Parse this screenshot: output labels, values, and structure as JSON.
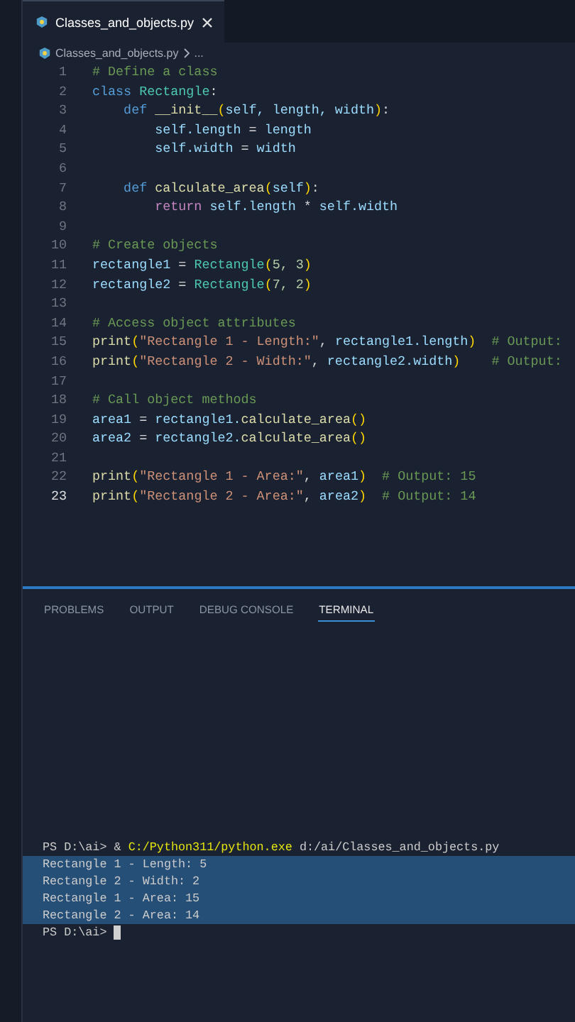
{
  "tab": {
    "label": "Classes_and_objects.py",
    "selected": true
  },
  "breadcrumb": {
    "file": "Classes_and_objects.py",
    "rest": "..."
  },
  "code": [
    {
      "number": "1",
      "active": false,
      "tokens": [
        {
          "kind": "comment",
          "t": "# Define a class"
        }
      ]
    },
    {
      "number": "2",
      "active": false,
      "tokens": [
        {
          "kind": "keyword",
          "t": "class "
        },
        {
          "kind": "cls",
          "t": "Rectangle"
        },
        {
          "kind": "punct",
          "t": ":"
        }
      ]
    },
    {
      "number": "3",
      "active": false,
      "tokens": [
        {
          "kind": "keyword",
          "t": "    def "
        },
        {
          "kind": "func",
          "t": "__init__"
        },
        {
          "kind": "paren",
          "t": "("
        },
        {
          "kind": "var",
          "t": "self, length, width"
        },
        {
          "kind": "paren",
          "t": ")"
        },
        {
          "kind": "punct",
          "t": ":"
        }
      ]
    },
    {
      "number": "4",
      "active": false,
      "tokens": [
        {
          "kind": "var",
          "t": "        self.length"
        },
        {
          "kind": "punct",
          "t": " = "
        },
        {
          "kind": "var",
          "t": "length"
        }
      ]
    },
    {
      "number": "5",
      "active": false,
      "tokens": [
        {
          "kind": "var",
          "t": "        self.width"
        },
        {
          "kind": "punct",
          "t": " = "
        },
        {
          "kind": "var",
          "t": "width"
        }
      ]
    },
    {
      "number": "6",
      "active": false
    },
    {
      "number": "7",
      "active": false,
      "tokens": [
        {
          "kind": "keyword",
          "t": "    def "
        },
        {
          "kind": "func",
          "t": "calculate_area"
        },
        {
          "kind": "paren",
          "t": "("
        },
        {
          "kind": "var",
          "t": "self"
        },
        {
          "kind": "paren",
          "t": ")"
        },
        {
          "kind": "punct",
          "t": ":"
        }
      ]
    },
    {
      "number": "8",
      "active": false,
      "tokens": [
        {
          "kind": "control",
          "t": "        return "
        },
        {
          "kind": "var",
          "t": "self.length"
        },
        {
          "kind": "punct",
          "t": " * "
        },
        {
          "kind": "var",
          "t": "self.width"
        }
      ]
    },
    {
      "number": "9",
      "active": false
    },
    {
      "number": "10",
      "active": false,
      "tokens": [
        {
          "kind": "comment",
          "t": "# Create objects"
        }
      ]
    },
    {
      "number": "11",
      "active": false,
      "tokens": [
        {
          "kind": "var",
          "t": "rectangle1"
        },
        {
          "kind": "punct",
          "t": " = "
        },
        {
          "kind": "cls",
          "t": "Rectangle"
        },
        {
          "kind": "paren",
          "t": "("
        },
        {
          "kind": "num",
          "t": "5, 3"
        },
        {
          "kind": "paren",
          "t": ")"
        }
      ]
    },
    {
      "number": "12",
      "active": false,
      "tokens": [
        {
          "kind": "var",
          "t": "rectangle2"
        },
        {
          "kind": "punct",
          "t": " = "
        },
        {
          "kind": "cls",
          "t": "Rectangle"
        },
        {
          "kind": "paren",
          "t": "("
        },
        {
          "kind": "num",
          "t": "7, 2"
        },
        {
          "kind": "paren",
          "t": ")"
        }
      ]
    },
    {
      "number": "13",
      "active": false
    },
    {
      "number": "14",
      "active": false,
      "tokens": [
        {
          "kind": "comment",
          "t": "# Access object attributes"
        }
      ]
    },
    {
      "number": "15",
      "active": false,
      "tokens": [
        {
          "kind": "func",
          "t": "print"
        },
        {
          "kind": "paren",
          "t": "("
        },
        {
          "kind": "str",
          "t": "\"Rectangle 1 - Length:\""
        },
        {
          "kind": "punct",
          "t": ", "
        },
        {
          "kind": "var",
          "t": "rectangle1.length"
        },
        {
          "kind": "paren",
          "t": ")  "
        },
        {
          "kind": "comment",
          "t": "# Output:"
        }
      ]
    },
    {
      "number": "16",
      "active": false,
      "tokens": [
        {
          "kind": "func",
          "t": "print"
        },
        {
          "kind": "paren",
          "t": "("
        },
        {
          "kind": "str",
          "t": "\"Rectangle 2 - Width:\""
        },
        {
          "kind": "punct",
          "t": ", "
        },
        {
          "kind": "var",
          "t": "rectangle2.width"
        },
        {
          "kind": "paren",
          "t": ")    "
        },
        {
          "kind": "comment",
          "t": "# Output:"
        }
      ]
    },
    {
      "number": "17",
      "active": false
    },
    {
      "number": "18",
      "active": false,
      "tokens": [
        {
          "kind": "comment",
          "t": "# Call object methods"
        }
      ]
    },
    {
      "number": "19",
      "active": false,
      "tokens": [
        {
          "kind": "var",
          "t": "area1"
        },
        {
          "kind": "punct",
          "t": " = "
        },
        {
          "kind": "var",
          "t": "rectangle1."
        },
        {
          "kind": "func",
          "t": "calculate_area"
        },
        {
          "kind": "paren",
          "t": "()"
        }
      ]
    },
    {
      "number": "20",
      "active": false,
      "tokens": [
        {
          "kind": "var",
          "t": "area2"
        },
        {
          "kind": "punct",
          "t": " = "
        },
        {
          "kind": "var",
          "t": "rectangle2."
        },
        {
          "kind": "func",
          "t": "calculate_area"
        },
        {
          "kind": "paren",
          "t": "()"
        }
      ]
    },
    {
      "number": "21",
      "active": false
    },
    {
      "number": "22",
      "active": false,
      "tokens": [
        {
          "kind": "func",
          "t": "print"
        },
        {
          "kind": "paren",
          "t": "("
        },
        {
          "kind": "str",
          "t": "\"Rectangle 1 - Area:\""
        },
        {
          "kind": "punct",
          "t": ", "
        },
        {
          "kind": "var",
          "t": "area1"
        },
        {
          "kind": "paren",
          "t": ")  "
        },
        {
          "kind": "comment",
          "t": "# Output: 15"
        }
      ]
    },
    {
      "number": "23",
      "active": true,
      "tokens": [
        {
          "kind": "func",
          "t": "print"
        },
        {
          "kind": "paren",
          "t": "("
        },
        {
          "kind": "str",
          "t": "\"Rectangle 2 - Area:\""
        },
        {
          "kind": "punct",
          "t": ", "
        },
        {
          "kind": "var",
          "t": "area2"
        },
        {
          "kind": "paren",
          "t": ")  "
        },
        {
          "kind": "comment",
          "t": "# Output: 14"
        }
      ]
    }
  ],
  "panel_tabs": [
    {
      "label": "PROBLEMS",
      "selected": false
    },
    {
      "label": "OUTPUT",
      "selected": false
    },
    {
      "label": "DEBUG CONSOLE",
      "selected": false
    },
    {
      "label": "TERMINAL",
      "selected": true
    }
  ],
  "terminal": [
    {
      "selected": false,
      "cursor": false,
      "tokens": [
        {
          "kind": "plain",
          "t": "PS D:\\ai> & "
        },
        {
          "kind": "path",
          "t": "C:/Python311/python.exe"
        },
        {
          "kind": "plain",
          "t": " d:/ai/Classes_and_objects.py"
        }
      ]
    },
    {
      "selected": true,
      "cursor": false,
      "tokens": [
        {
          "kind": "plain",
          "t": "Rectangle 1 - Length: 5"
        }
      ]
    },
    {
      "selected": true,
      "cursor": false,
      "tokens": [
        {
          "kind": "plain",
          "t": "Rectangle 2 - Width: 2"
        }
      ]
    },
    {
      "selected": true,
      "cursor": false,
      "tokens": [
        {
          "kind": "plain",
          "t": "Rectangle 1 - Area: 15"
        }
      ]
    },
    {
      "selected": true,
      "cursor": false,
      "tokens": [
        {
          "kind": "plain",
          "t": "Rectangle 2 - Area: 14"
        }
      ]
    },
    {
      "selected": false,
      "cursor": true,
      "tokens": [
        {
          "kind": "plain",
          "t": "PS D:\\ai>"
        }
      ]
    }
  ]
}
